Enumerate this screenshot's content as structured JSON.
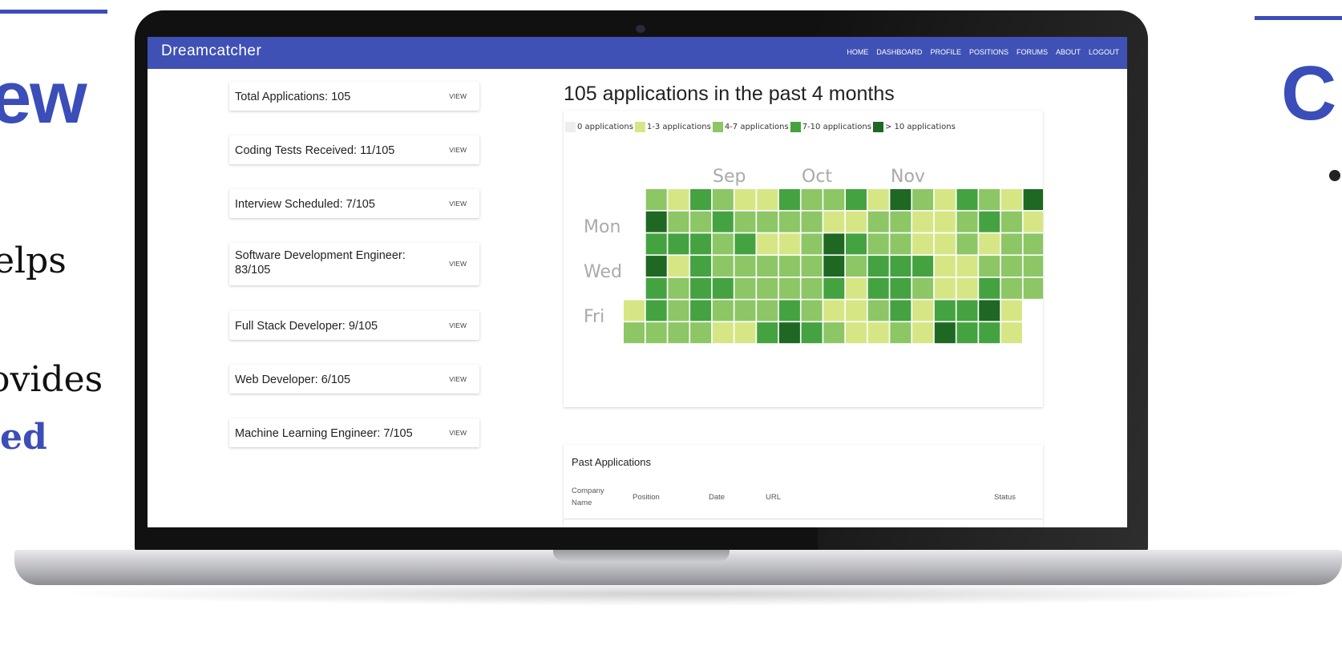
{
  "slide": {
    "heading_left": "ew",
    "heading_right": "C",
    "text_lines": [
      "elps",
      "ovides",
      "ed"
    ]
  },
  "app": {
    "brand": "Dreamcatcher",
    "nav": [
      "HOME",
      "DASHBOARD",
      "PROFILE",
      "POSITIONS",
      "FORUMS",
      "ABOUT",
      "LOGOUT"
    ]
  },
  "stats": [
    {
      "label": "Total Applications: 105",
      "action": "VIEW"
    },
    {
      "label": "Coding Tests Received: 11/105",
      "action": "VIEW"
    },
    {
      "label": "Interview Scheduled: 7/105",
      "action": "VIEW"
    },
    {
      "label": "Software Development Engineer: 83/105",
      "action": "VIEW"
    },
    {
      "label": "Full Stack Developer: 9/105",
      "action": "VIEW"
    },
    {
      "label": "Web Developer: 6/105",
      "action": "VIEW"
    },
    {
      "label": "Machine Learning Engineer: 7/105",
      "action": "VIEW"
    }
  ],
  "heatmap": {
    "title": "105 applications in the past 4 months",
    "legend": [
      {
        "label": "0 applications",
        "color": "#eeeeee"
      },
      {
        "label": "1-3 applications",
        "color": "#d6e685"
      },
      {
        "label": "4-7 applications",
        "color": "#8cc665"
      },
      {
        "label": "7-10 applications",
        "color": "#44a340"
      },
      {
        "label": "> 10 applications",
        "color": "#1e6823"
      }
    ],
    "months": [
      "Sep",
      "Oct",
      "Nov"
    ],
    "weekdays": [
      "Mon",
      "Wed",
      "Fri"
    ],
    "weeks": [
      [
        0,
        0,
        0,
        0,
        0,
        1,
        2
      ],
      [
        2,
        4,
        3,
        4,
        3,
        3,
        2
      ],
      [
        1,
        2,
        3,
        1,
        2,
        2,
        2
      ],
      [
        3,
        2,
        3,
        3,
        3,
        3,
        2
      ],
      [
        2,
        3,
        2,
        2,
        3,
        2,
        1
      ],
      [
        1,
        2,
        3,
        2,
        2,
        2,
        1
      ],
      [
        1,
        2,
        1,
        2,
        2,
        2,
        3
      ],
      [
        3,
        2,
        1,
        2,
        2,
        3,
        4
      ],
      [
        2,
        2,
        2,
        2,
        2,
        2,
        3
      ],
      [
        2,
        1,
        4,
        4,
        3,
        1,
        2
      ],
      [
        3,
        1,
        3,
        2,
        1,
        1,
        1
      ],
      [
        1,
        2,
        2,
        3,
        3,
        2,
        1
      ],
      [
        4,
        2,
        2,
        3,
        3,
        3,
        2
      ],
      [
        2,
        1,
        1,
        3,
        2,
        1,
        1
      ],
      [
        1,
        1,
        1,
        1,
        1,
        3,
        4
      ],
      [
        3,
        2,
        2,
        1,
        1,
        3,
        3
      ],
      [
        2,
        3,
        1,
        2,
        3,
        4,
        3
      ],
      [
        1,
        2,
        2,
        2,
        2,
        1,
        1
      ],
      [
        4,
        1,
        2,
        2,
        2,
        0,
        0
      ]
    ]
  },
  "table": {
    "title": "Past Applications",
    "headers": [
      "Company Name",
      "Position",
      "Date",
      "URL",
      "Status"
    ]
  }
}
